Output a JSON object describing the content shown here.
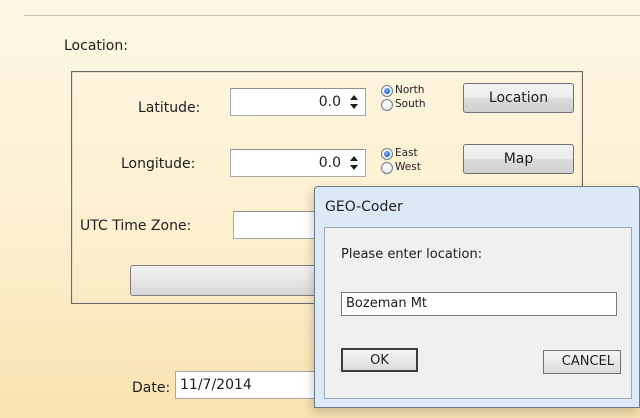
{
  "form": {
    "section_title": "Location:",
    "latitude": {
      "label": "Latitude:",
      "value": "0.0",
      "options": [
        "North",
        "South"
      ],
      "selected": "North"
    },
    "longitude": {
      "label": "Longitude:",
      "value": "0.0",
      "options": [
        "East",
        "West"
      ],
      "selected": "East"
    },
    "utc": {
      "label": "UTC Time Zone:"
    },
    "location_button": "Location",
    "map_button": "Map",
    "date": {
      "label": "Date:",
      "value": "11/7/2014"
    }
  },
  "dialog": {
    "title": "GEO-Coder",
    "prompt": "Please enter location:",
    "input_value": "Bozeman Mt",
    "ok_label": "OK",
    "cancel_label": "CANCEL"
  },
  "icons": {
    "spinner_arrows": "up-down-arrows-icon"
  },
  "colors": {
    "background_top": "#fff7e4",
    "background_bottom": "#f8e2b0",
    "dialog_frame": "#dce9f6",
    "radio_checked": "#2167c8"
  }
}
